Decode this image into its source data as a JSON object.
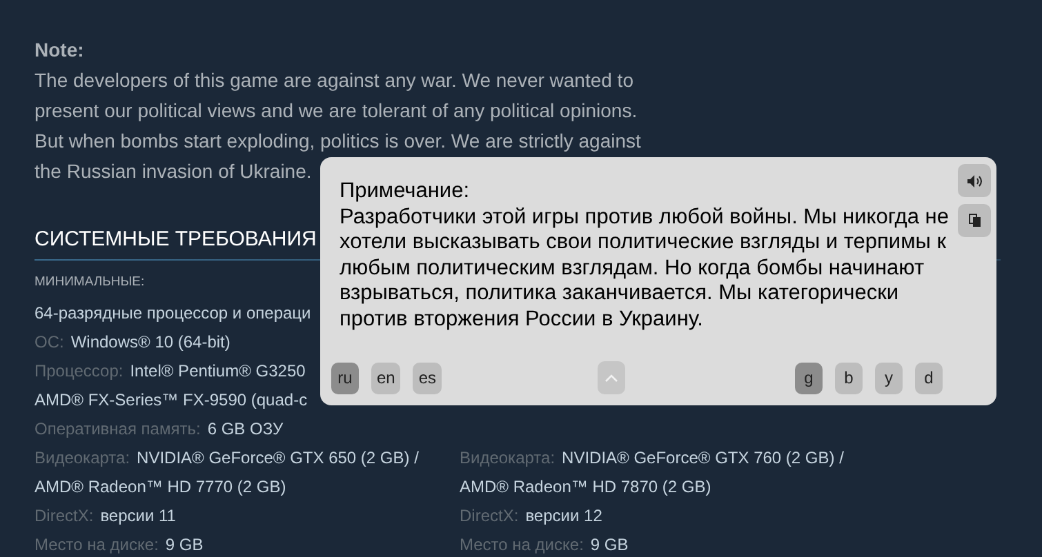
{
  "note": {
    "title": "Note:",
    "text": "The developers of this game are against any war. We never wanted to present our political views and we are tolerant of any political opinions. But when bombs start exploding, politics is over. We are strictly against the Russian invasion of Ukraine."
  },
  "requirements": {
    "heading": "СИСТЕМНЫЕ ТРЕБОВАНИЯ",
    "minimum_label": "МИНИМАЛЬНЫЕ:",
    "minimum": [
      {
        "value": "64-разрядные процессор и операци"
      },
      {
        "label": "ОС:",
        "value": "Windows® 10 (64-bit)"
      },
      {
        "label": "Процессор:",
        "value": "Intel® Pentium® G3250"
      },
      {
        "value": "AMD® FX-Series™ FX-9590 (quad-c"
      },
      {
        "label": "Оперативная память:",
        "value": "6 GB ОЗУ"
      },
      {
        "label": "Видеокарта:",
        "value": "NVIDIA® GeForce® GTX 650 (2 GB) /"
      },
      {
        "value": "AMD® Radeon™ HD 7770 (2 GB)"
      },
      {
        "label": "DirectX:",
        "value": "версии 11"
      },
      {
        "label": "Место на диске:",
        "value": "9 GB"
      }
    ],
    "recommended": [
      {
        "label": "Видеокарта:",
        "value": "NVIDIA® GeForce® GTX 760 (2 GB) /"
      },
      {
        "value": "AMD® Radeon™ HD 7870 (2 GB)"
      },
      {
        "label": "DirectX:",
        "value": "версии 12"
      },
      {
        "label": "Место на диске:",
        "value": "9 GB"
      }
    ]
  },
  "translation_popup": {
    "title": "Примечание:",
    "text": "Разработчики этой игры против любой войны. Мы никогда не хотели высказывать свои политические взгляды и терпимы к любым политическим взглядам. Но когда бомбы начинают взрываться, политика заканчивается. Мы категорически против вторжения России в Украину.",
    "languages": [
      {
        "label": "ru",
        "selected": true
      },
      {
        "label": "en",
        "selected": false
      },
      {
        "label": "es",
        "selected": false
      }
    ],
    "engines": [
      {
        "label": "g",
        "selected": true
      },
      {
        "label": "b",
        "selected": false
      },
      {
        "label": "y",
        "selected": false
      },
      {
        "label": "d",
        "selected": false
      }
    ]
  }
}
